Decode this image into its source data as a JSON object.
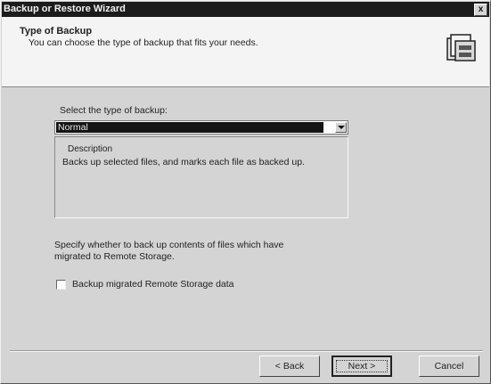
{
  "window": {
    "title": "Backup or Restore Wizard",
    "close_glyph": "x"
  },
  "header": {
    "title": "Type of Backup",
    "subtitle": "You can choose the type of backup that fits your needs.",
    "icon": "backup-icon"
  },
  "backup_type": {
    "label": "Select the type of backup:",
    "selected": "Normal"
  },
  "description": {
    "title": "Description",
    "text": "Backs up selected files, and marks each file as backed up."
  },
  "remote_storage": {
    "note_line1": "Specify whether to back up contents of files which have",
    "note_line2": "migrated to Remote Storage.",
    "checkbox_label": "Backup migrated Remote Storage data",
    "checked": false
  },
  "buttons": {
    "back": "< Back",
    "next": "Next >",
    "cancel": "Cancel"
  }
}
